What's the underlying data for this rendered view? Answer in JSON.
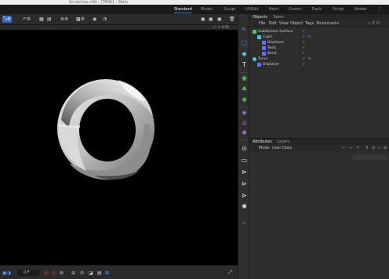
{
  "window": {
    "title": "Scratches.c4d – [TASK] – Main"
  },
  "layouts": {
    "tabs": [
      {
        "label": "Standard",
        "active": true
      },
      {
        "label": "Model",
        "active": false
      },
      {
        "label": "Sculpt",
        "active": false
      },
      {
        "label": "UVEdit",
        "active": false
      },
      {
        "label": "Paint",
        "active": false
      },
      {
        "label": "Groom",
        "active": false
      },
      {
        "label": "Track",
        "active": false
      },
      {
        "label": "Script",
        "active": false
      },
      {
        "label": "Nodes",
        "active": false
      }
    ],
    "more_icon": "vertical-dots-icon"
  },
  "viewport_toolbar": {
    "left_icons": [
      "move-tool-icon",
      "undo-icon",
      "snap-icon",
      "workplane-icon",
      "axis-icon",
      "render-region-icon",
      "record-icon",
      "timer-icon"
    ],
    "right_icons": [
      "render-view-icon",
      "render-picture-viewer-icon",
      "render-settings-icon",
      "trash-icon"
    ]
  },
  "viewport": {
    "background_color": "#000000",
    "object": "twisted-torus"
  },
  "bottom_toolbar": {
    "frame_field": "0 F",
    "icons": [
      "camera-icon",
      "record-active-icon",
      "keyframe-icon",
      "autokey-icon",
      "grid-icon",
      "snap-icon",
      "render-icon",
      "timeline-icon",
      "expand-icon"
    ]
  },
  "palette": {
    "icons": [
      {
        "name": "cursor-icon",
        "color": "#5aa0ff"
      },
      {
        "name": "cube-icon",
        "color": "#5aa0ff"
      },
      {
        "name": "cube-solid-icon",
        "color": "#4fc3ff"
      },
      {
        "name": "text-icon",
        "color": "#e6e6e6"
      },
      {
        "name": "pen-icon",
        "color": "#7ec8ff"
      },
      {
        "name": "generator-icon",
        "color": "#53c653"
      },
      {
        "name": "subdivision-icon",
        "color": "#53c653"
      },
      {
        "name": "deformer-icon",
        "color": "#53c653"
      },
      {
        "name": "field-icon",
        "color": "#a67cff"
      },
      {
        "name": "tag-icon",
        "color": "#a67cff"
      },
      {
        "name": "scene-icon",
        "color": "#c77dff"
      },
      {
        "name": "camera-icon",
        "color": "#e6e6e6"
      },
      {
        "name": "clapper-icon",
        "color": "#e6e6e6"
      },
      {
        "name": "render-icon",
        "color": "#e6e6e6"
      },
      {
        "name": "render-to-po-icon",
        "color": "#e6e6e6"
      },
      {
        "name": "render-queue-icon",
        "color": "#e6e6e6"
      },
      {
        "name": "light-icon",
        "color": "#e6e6e6"
      },
      {
        "name": "python-icon",
        "color": "#777777"
      }
    ]
  },
  "object_manager": {
    "tabs": [
      {
        "label": "Objects",
        "active": true
      },
      {
        "label": "Takes",
        "active": false
      }
    ],
    "menu": [
      "File",
      "Edit",
      "View",
      "Object",
      "Tags",
      "Bookmarks"
    ],
    "objects": [
      {
        "name": "Subdivision Surface",
        "indent": 0,
        "icon_color": "#53c653",
        "tag": ""
      },
      {
        "name": "Cube",
        "indent": 1,
        "icon_color": "#4fc3ff",
        "tag": "phong-tag"
      },
      {
        "name": "Displacer",
        "indent": 2,
        "icon_color": "#6b6bff",
        "tag": ""
      },
      {
        "name": "Twist",
        "indent": 2,
        "icon_color": "#6b6bff",
        "tag": ""
      },
      {
        "name": "Bend",
        "indent": 2,
        "icon_color": "#6b6bff",
        "tag": ""
      },
      {
        "name": "Torus",
        "indent": 0,
        "icon_color": "#4fc3ff",
        "tag": "phong-tag"
      },
      {
        "name": "Displacer",
        "indent": 1,
        "icon_color": "#6b6bff",
        "tag": ""
      }
    ]
  },
  "attributes": {
    "tabs": [
      {
        "label": "Attributes",
        "active": true
      },
      {
        "label": "Layers",
        "active": false
      }
    ],
    "menu": [
      "Mode",
      "User Data"
    ],
    "nav_icons": [
      "back-icon",
      "forward-icon",
      "up-icon",
      "filter-icon",
      "lock-icon",
      "new-window-icon"
    ]
  }
}
